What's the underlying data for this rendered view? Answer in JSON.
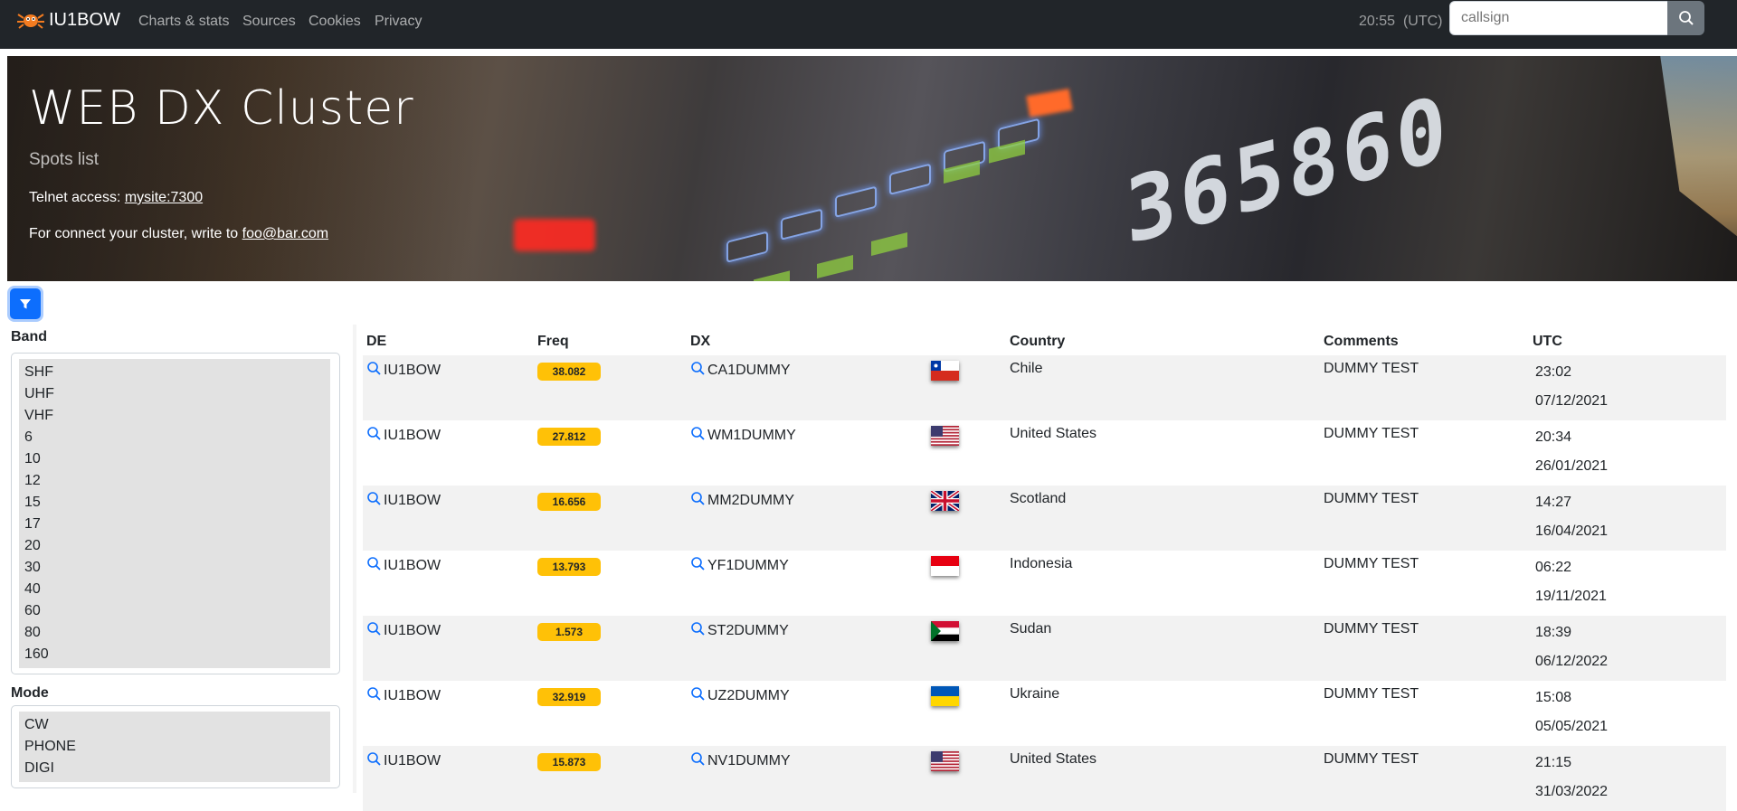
{
  "navbar": {
    "brand": "IU1BOW",
    "links": [
      "Charts & stats",
      "Sources",
      "Cookies",
      "Privacy"
    ],
    "clock": "20:55",
    "clock_tz": "(UTC)",
    "search_placeholder": "callsign"
  },
  "hero": {
    "title": "WEB DX Cluster",
    "subtitle": "Spots list",
    "telnet_label": "Telnet access:",
    "telnet_link": "mysite:7300",
    "contact_label": "For connect your cluster, write to",
    "contact_link": "foo@bar.com"
  },
  "filters": {
    "band_label": "Band",
    "bands": [
      "SHF",
      "UHF",
      "VHF",
      "6",
      "10",
      "12",
      "15",
      "17",
      "20",
      "30",
      "40",
      "60",
      "80",
      "160"
    ],
    "mode_label": "Mode",
    "modes": [
      "CW",
      "PHONE",
      "DIGI"
    ]
  },
  "table": {
    "headers": {
      "de": "DE",
      "freq": "Freq",
      "dx": "DX",
      "country": "Country",
      "comments": "Comments",
      "utc": "UTC"
    },
    "rows": [
      {
        "de": "IU1BOW",
        "freq": "38.082",
        "dx": "CA1DUMMY",
        "flag": "chile",
        "country": "Chile",
        "comments": "DUMMY TEST",
        "time": "23:02",
        "date": "07/12/2021"
      },
      {
        "de": "IU1BOW",
        "freq": "27.812",
        "dx": "WM1DUMMY",
        "flag": "usa",
        "country": "United States",
        "comments": "DUMMY TEST",
        "time": "20:34",
        "date": "26/01/2021"
      },
      {
        "de": "IU1BOW",
        "freq": "16.656",
        "dx": "MM2DUMMY",
        "flag": "uk",
        "country": "Scotland",
        "comments": "DUMMY TEST",
        "time": "14:27",
        "date": "16/04/2021"
      },
      {
        "de": "IU1BOW",
        "freq": "13.793",
        "dx": "YF1DUMMY",
        "flag": "indonesia",
        "country": "Indonesia",
        "comments": "DUMMY TEST",
        "time": "06:22",
        "date": "19/11/2021"
      },
      {
        "de": "IU1BOW",
        "freq": "1.573",
        "dx": "ST2DUMMY",
        "flag": "sudan",
        "country": "Sudan",
        "comments": "DUMMY TEST",
        "time": "18:39",
        "date": "06/12/2022"
      },
      {
        "de": "IU1BOW",
        "freq": "32.919",
        "dx": "UZ2DUMMY",
        "flag": "ukraine",
        "country": "Ukraine",
        "comments": "DUMMY TEST",
        "time": "15:08",
        "date": "05/05/2021"
      },
      {
        "de": "IU1BOW",
        "freq": "15.873",
        "dx": "NV1DUMMY",
        "flag": "usa",
        "country": "United States",
        "comments": "DUMMY TEST",
        "time": "21:15",
        "date": "31/03/2022"
      }
    ]
  },
  "colors": {
    "navbar_bg": "#212529",
    "freq_badge": "#ffc107",
    "filter_button": "#0d6efd",
    "search_icon_link": "#0d6efd"
  }
}
